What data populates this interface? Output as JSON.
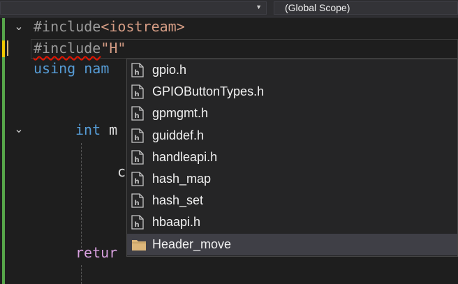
{
  "navigation_bar": {
    "scope_selector": "(Global Scope)"
  },
  "editor": {
    "lines": {
      "l1_directive": "#include",
      "l1_header": "<iostream>",
      "l2_directive": "#include",
      "l2_header": "\"H\"",
      "l3_keyword": "using",
      "l3_rest": "nam",
      "l5_keyword": "int",
      "l5_rest": "m",
      "l6_rest": "c",
      "l8_keyword": "retur"
    }
  },
  "intellisense": {
    "items": [
      {
        "label": "gpio.h",
        "icon": "header-file-icon"
      },
      {
        "label": "GPIOButtonTypes.h",
        "icon": "header-file-icon"
      },
      {
        "label": "gpmgmt.h",
        "icon": "header-file-icon"
      },
      {
        "label": "guiddef.h",
        "icon": "header-file-icon"
      },
      {
        "label": "handleapi.h",
        "icon": "header-file-icon"
      },
      {
        "label": "hash_map",
        "icon": "header-file-icon"
      },
      {
        "label": "hash_set",
        "icon": "header-file-icon"
      },
      {
        "label": "hbaapi.h",
        "icon": "header-file-icon"
      },
      {
        "label": "Header_move",
        "icon": "folder-icon",
        "selected": true
      }
    ]
  },
  "colors": {
    "background": "#1e1e1e",
    "keyword": "#569cd6",
    "preprocessor": "#9b9b9b",
    "include_string": "#d69d85",
    "return_keyword": "#d8a0df",
    "change_bar": "#57a64a",
    "folder": "#dcb67a"
  }
}
